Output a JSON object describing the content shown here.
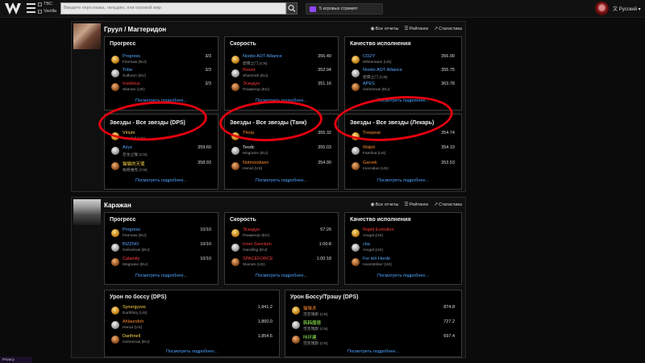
{
  "topbar": {
    "versions": [
      "TBC",
      "Vanilla"
    ],
    "search_placeholder": "Введите персонажа, гильдию, или игровой мир",
    "streams_label": "5 игровых стримят",
    "language": "Русский"
  },
  "zone1": {
    "title": "Груул / Магтеридон",
    "links": [
      "Все отчеты",
      "Рейтинги",
      "Статистика"
    ],
    "cards": [
      {
        "title": "Прогресс",
        "more": "Посмотреть подробнее...",
        "rows": [
          {
            "name": "Progress",
            "server": "Firemaw (EU)",
            "value": "3/3",
            "color": "c-blue",
            "medal": "gold"
          },
          {
            "name": "Tribe",
            "server": "Sulfuron (EU)",
            "value": "3/3",
            "color": "c-blue",
            "medal": "silver"
          },
          {
            "name": "Insidious",
            "server": "Skeram (US)",
            "value": "3/3",
            "color": "c-red",
            "medal": "bronze"
          }
        ]
      },
      {
        "title": "Скорость",
        "more": "Посмотреть подробнее...",
        "rows": [
          {
            "name": "Noobs AOT Alliance",
            "server": "碧霄之门 (CN)",
            "value": "356.40",
            "color": "c-blue",
            "medal": "gold"
          },
          {
            "name": "Resist",
            "server": "Shazzrah (EU)",
            "value": "352.94",
            "color": "c-red",
            "medal": "silver"
          },
          {
            "name": "Эскадун",
            "server": "Пламегор (EU)",
            "value": "351.16",
            "color": "c-red",
            "medal": "bronze"
          }
        ]
      },
      {
        "title": "Качество исполнения",
        "more": "Посмотреть подробнее...",
        "rows": [
          {
            "name": "COZY",
            "server": "Whitemane (US)",
            "value": "356.99",
            "color": "c-blue",
            "medal": "gold"
          },
          {
            "name": "Noobs AOT Alliance",
            "server": "碧霄之门 (CN)",
            "value": "355.75",
            "color": "c-blue",
            "medal": "silver"
          },
          {
            "name": "APES",
            "server": "Gehennas (EU)",
            "value": "363.78",
            "color": "c-blue",
            "medal": "bronze"
          }
        ]
      },
      {
        "title": "Звезды - Все звезды (DPS)",
        "more": "Посмотреть подробнее...",
        "rows": [
          {
            "name": "Virium",
            "server": "Westfall (US)",
            "value": "",
            "color": "c-yellow",
            "medal": "gold"
          },
          {
            "name": "Azyx",
            "server": "巨龙之喉 (CN)",
            "value": "359.60",
            "color": "c-blue",
            "medal": "silver"
          },
          {
            "name": "猫猫的天使",
            "server": "帕奇维克 (CN)",
            "value": "358.93",
            "color": "c-yellow",
            "medal": "bronze"
          }
        ]
      },
      {
        "title": "Звезды - Все звезды (Танк)",
        "more": "Посмотреть подробнее...",
        "rows": [
          {
            "name": "Thorp",
            "server": "",
            "value": "355.32",
            "color": "c-orange",
            "medal": "gold"
          },
          {
            "name": "Teodc",
            "server": "Mograine (EU)",
            "value": "355.03",
            "color": "",
            "medal": "silver"
          },
          {
            "name": "Notmoodwen",
            "server": "Herod (US)",
            "value": "354.90",
            "color": "c-orange",
            "medal": "bronze"
          }
        ]
      },
      {
        "title": "Звезды - Все звезды (Лекарь)",
        "more": "Посмотреть подробнее...",
        "rows": [
          {
            "name": "Treepeat",
            "server": "",
            "value": "354.74",
            "color": "c-orange",
            "medal": "gold"
          },
          {
            "name": "Walph",
            "server": "Faerlina (US)",
            "value": "354.19",
            "color": "c-orange",
            "medal": "silver"
          },
          {
            "name": "Garvek",
            "server": "Incendius (US)",
            "value": "353.53",
            "color": "c-orange",
            "medal": "bronze"
          }
        ]
      }
    ]
  },
  "zone2": {
    "title": "Каражан",
    "links": [
      "Все отчеты",
      "Рейтинги",
      "Статистика"
    ],
    "cards": [
      {
        "title": "Прогресс",
        "more": "Посмотреть подробнее...",
        "rows": [
          {
            "name": "Progress",
            "server": "Firemaw (EU)",
            "value": "10/10",
            "color": "c-blue",
            "medal": "gold"
          },
          {
            "name": "BIZZNO",
            "server": "Gehennas (EU)",
            "value": "10/10",
            "color": "c-blue",
            "medal": "silver"
          },
          {
            "name": "Calamity",
            "server": "Mograine (EU)",
            "value": "10/10",
            "color": "c-red",
            "medal": "bronze"
          }
        ]
      },
      {
        "title": "Скорость",
        "more": "Посмотреть подробнее...",
        "rows": [
          {
            "name": "Эскадун",
            "server": "Пламегор (EU)",
            "value": "57:26",
            "color": "c-red",
            "medal": "gold"
          },
          {
            "name": "Inner Sanctum",
            "server": "Gandling (EU)",
            "value": "1:00:8",
            "color": "c-red",
            "medal": "silver"
          },
          {
            "name": "SPACEFORCE",
            "server": "Skeram (US)",
            "value": "1:00:18",
            "color": "c-red",
            "medal": "bronze"
          }
        ]
      },
      {
        "title": "Качество исполнения",
        "more": "Посмотреть подробнее...",
        "rows": [
          {
            "name": "Rapid Evolution",
            "server": "Arugal (US)",
            "value": "",
            "color": "c-red",
            "medal": "gold"
          },
          {
            "name": "cba",
            "server": "Arugal (US)",
            "value": "",
            "color": "c-blue",
            "medal": "silver"
          },
          {
            "name": "For teh Horde",
            "server": "Heartstriker (US)",
            "value": "",
            "color": "c-blue",
            "medal": "bronze"
          }
        ]
      },
      {
        "title": "Урон по боссу (DPS)",
        "more": "Посмотреть подробнее...",
        "rows": [
          {
            "name": "Synergyzos",
            "server": "Earthfury (US)",
            "value": "1,941.2",
            "color": "c-yellow",
            "medal": "gold"
          },
          {
            "name": "Ahlaundoh",
            "server": "Herod (US)",
            "value": "1,860.0",
            "color": "c-orange",
            "medal": "silver"
          },
          {
            "name": "Darthnell",
            "server": "Gehennas (EU)",
            "value": "1,854.5",
            "color": "c-yellow",
            "medal": "bronze"
          }
        ]
      },
      {
        "title": "Урон Боссу/Трэшу (DPS)",
        "more": "Посмотреть подробнее...",
        "rows": [
          {
            "name": "猫咪术",
            "server": "范克瑞斯 (CN)",
            "value": "874.8",
            "color": "c-orange",
            "medal": "gold"
          },
          {
            "name": "韩韩魔德",
            "server": "范克瑞斯 (CN)",
            "value": "727.2",
            "color": "c-green",
            "medal": "silver"
          },
          {
            "name": "咔环建",
            "server": "范克瑞斯 (CN)",
            "value": "697.4",
            "color": "c-green",
            "medal": "bronze"
          }
        ]
      }
    ]
  },
  "corner_label": "Privacy"
}
